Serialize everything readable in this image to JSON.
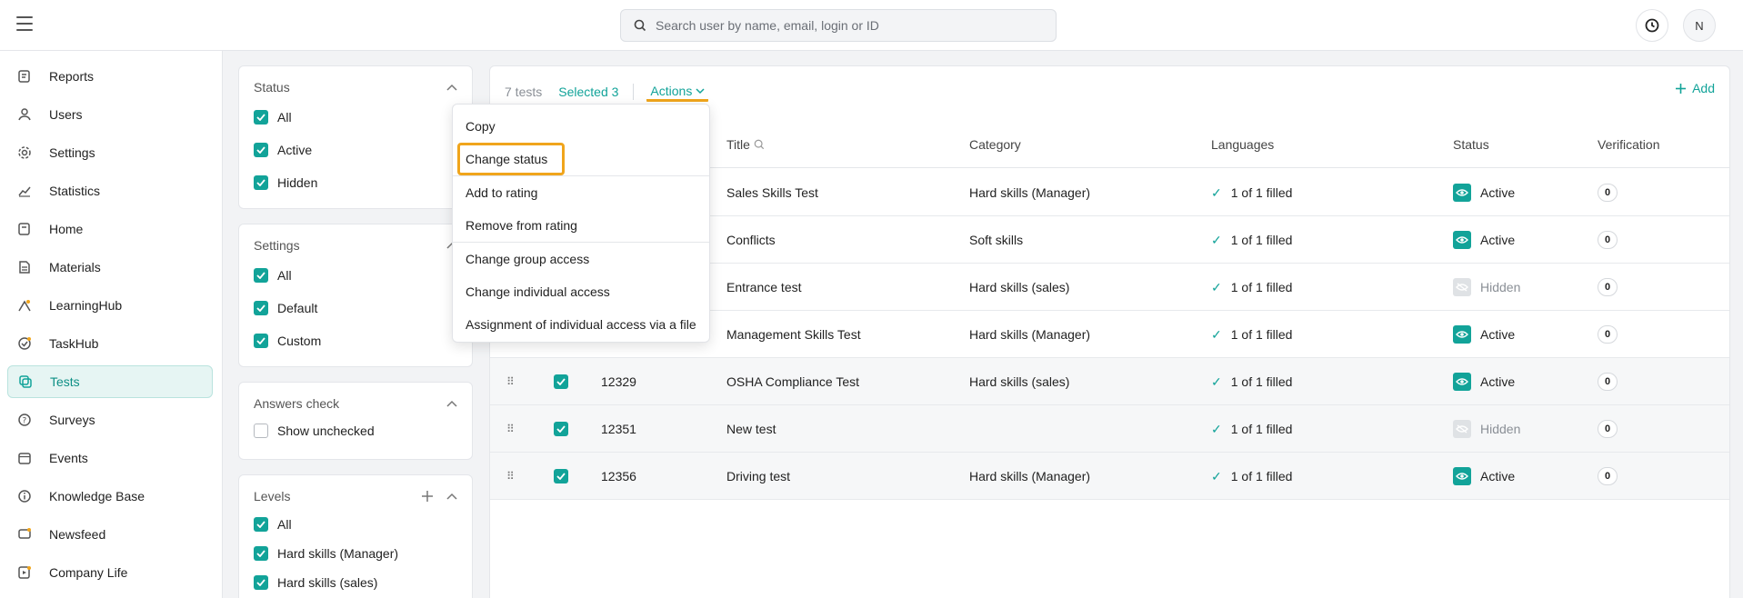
{
  "search": {
    "placeholder": "Search user by name, email, login or ID"
  },
  "header": {
    "avatar_initial": "N"
  },
  "sidebar": {
    "items": [
      {
        "label": "Reports",
        "icon": "reports-icon"
      },
      {
        "label": "Users",
        "icon": "users-icon"
      },
      {
        "label": "Settings",
        "icon": "gear-icon"
      },
      {
        "label": "Statistics",
        "icon": "chart-icon"
      },
      {
        "label": "Home",
        "icon": "home-icon"
      },
      {
        "label": "Materials",
        "icon": "document-icon"
      },
      {
        "label": "LearningHub",
        "icon": "learninghub-icon"
      },
      {
        "label": "TaskHub",
        "icon": "task-icon"
      },
      {
        "label": "Tests",
        "icon": "tests-icon",
        "active": true
      },
      {
        "label": "Surveys",
        "icon": "survey-icon"
      },
      {
        "label": "Events",
        "icon": "calendar-icon"
      },
      {
        "label": "Knowledge Base",
        "icon": "info-icon"
      },
      {
        "label": "Newsfeed",
        "icon": "newsfeed-icon"
      },
      {
        "label": "Company Life",
        "icon": "company-life-icon"
      }
    ]
  },
  "filters": {
    "status": {
      "title": "Status",
      "options": [
        {
          "label": "All",
          "checked": true
        },
        {
          "label": "Active",
          "checked": true
        },
        {
          "label": "Hidden",
          "checked": true
        }
      ]
    },
    "settings": {
      "title": "Settings",
      "options": [
        {
          "label": "All",
          "checked": true
        },
        {
          "label": "Default",
          "checked": true
        },
        {
          "label": "Custom",
          "checked": true
        }
      ]
    },
    "answers": {
      "title": "Answers check",
      "options": [
        {
          "label": "Show unchecked",
          "checked": false
        }
      ]
    },
    "levels": {
      "title": "Levels",
      "options": [
        {
          "label": "All",
          "checked": true
        },
        {
          "label": "Hard skills (Manager)",
          "checked": true
        },
        {
          "label": "Hard skills (sales)",
          "checked": true
        }
      ]
    }
  },
  "toolbar": {
    "count": "7 tests",
    "selected": "Selected 3",
    "actions": "Actions",
    "add": "Add"
  },
  "table": {
    "headers": {
      "title": "Title",
      "category": "Category",
      "languages": "Languages",
      "status": "Status",
      "verification": "Verification"
    },
    "rows": [
      {
        "id": "",
        "title": "Sales Skills Test",
        "category": "Hard skills (Manager)",
        "languages": "1 of 1 filled",
        "status": "Active",
        "verification": "0"
      },
      {
        "id": "",
        "title": "Conflicts",
        "category": "Soft skills",
        "languages": "1 of 1 filled",
        "status": "Active",
        "verification": "0"
      },
      {
        "id": "",
        "title": "Entrance test",
        "category": "Hard skills (sales)",
        "languages": "1 of 1 filled",
        "status": "Hidden",
        "verification": "0"
      },
      {
        "id": "",
        "title": "Management Skills Test",
        "category": "Hard skills (Manager)",
        "languages": "1 of 1 filled",
        "status": "Active",
        "verification": "0"
      },
      {
        "id": "12329",
        "title": "OSHA Compliance Test",
        "category": "Hard skills (sales)",
        "languages": "1 of 1 filled",
        "status": "Active",
        "verification": "0",
        "checked": true
      },
      {
        "id": "12351",
        "title": "New test",
        "category": "",
        "languages": "1 of 1 filled",
        "status": "Hidden",
        "verification": "0",
        "checked": true
      },
      {
        "id": "12356",
        "title": "Driving test",
        "category": "Hard skills (Manager)",
        "languages": "1 of 1 filled",
        "status": "Active",
        "verification": "0",
        "checked": true
      }
    ]
  },
  "actions_menu": {
    "items": [
      {
        "label": "Copy"
      },
      {
        "label": "Change status",
        "focused": true
      },
      {
        "label": "Add to rating"
      },
      {
        "label": "Remove from rating"
      },
      {
        "label": "Change group access"
      },
      {
        "label": "Change individual access"
      },
      {
        "label": "Assignment of individual access via a file"
      }
    ]
  },
  "colors": {
    "accent": "#12a399",
    "highlight": "#f0a51c"
  }
}
